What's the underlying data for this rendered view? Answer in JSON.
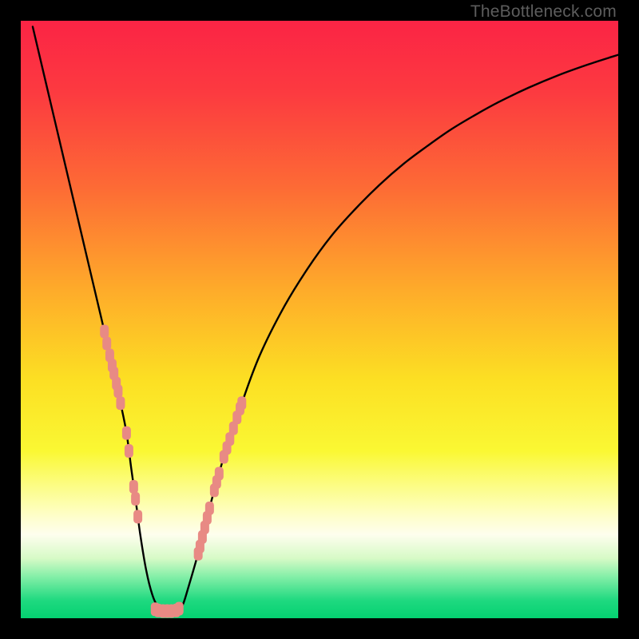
{
  "watermark": "TheBottleneck.com",
  "colors": {
    "frame": "#000000",
    "curve": "#000000",
    "marker_fill": "#e88a84",
    "marker_stroke": "#e88a84",
    "gradient_stops": [
      {
        "offset": "0%",
        "color": "#fb2445"
      },
      {
        "offset": "12%",
        "color": "#fc3a40"
      },
      {
        "offset": "28%",
        "color": "#fd6b35"
      },
      {
        "offset": "45%",
        "color": "#feab2a"
      },
      {
        "offset": "60%",
        "color": "#fcdf23"
      },
      {
        "offset": "72%",
        "color": "#faf833"
      },
      {
        "offset": "78%",
        "color": "#fcfd87"
      },
      {
        "offset": "83%",
        "color": "#fefecb"
      },
      {
        "offset": "86%",
        "color": "#fefeee"
      },
      {
        "offset": "90%",
        "color": "#d6fac6"
      },
      {
        "offset": "93%",
        "color": "#85efa8"
      },
      {
        "offset": "97%",
        "color": "#1fd980"
      },
      {
        "offset": "100%",
        "color": "#04d171"
      }
    ]
  },
  "chart_data": {
    "type": "line",
    "title": "",
    "xlabel": "",
    "ylabel": "",
    "xlim": [
      0,
      100
    ],
    "ylim": [
      0,
      100
    ],
    "x": [
      0,
      2,
      4,
      6,
      8,
      10,
      12,
      14,
      15.6,
      16.7,
      17.7,
      18.5,
      19.2,
      20,
      21,
      22,
      23,
      24.5,
      26,
      27,
      28,
      30,
      32,
      34,
      37,
      40,
      44,
      48,
      52,
      56,
      60,
      64,
      68,
      72,
      76,
      80,
      85,
      90,
      95,
      100
    ],
    "values": [
      null,
      99,
      90.5,
      82,
      73.5,
      65,
      56.5,
      48,
      41,
      36,
      31,
      25,
      20,
      14,
      8,
      4,
      2,
      1.2,
      1.2,
      2,
      5,
      12,
      20,
      27,
      36,
      44,
      52,
      58.5,
      64,
      68.5,
      72.5,
      76,
      79,
      81.8,
      84.2,
      86.4,
      88.8,
      90.9,
      92.7,
      94.3
    ],
    "series": [
      {
        "name": "markers-left-upper",
        "x": [
          14.0,
          14.4,
          14.9,
          15.3,
          15.6,
          16.0,
          16.3,
          16.7
        ],
        "y": [
          48.0,
          46.0,
          44.0,
          42.3,
          41.0,
          39.3,
          38.0,
          36.0
        ]
      },
      {
        "name": "markers-left-mid",
        "x": [
          17.7,
          18.1
        ],
        "y": [
          31.0,
          28.0
        ]
      },
      {
        "name": "markers-left-lower",
        "x": [
          18.9,
          19.2,
          19.6
        ],
        "y": [
          22.0,
          20.0,
          17.0
        ]
      },
      {
        "name": "markers-valley",
        "x": [
          22.5,
          23.0,
          23.8,
          24.5,
          25.2,
          26.0,
          26.5
        ],
        "y": [
          1.5,
          1.3,
          1.2,
          1.2,
          1.2,
          1.3,
          1.6
        ]
      },
      {
        "name": "markers-right-lower",
        "x": [
          29.7,
          30.0,
          30.4,
          30.8,
          31.2,
          31.6
        ],
        "y": [
          10.8,
          12.0,
          13.6,
          15.2,
          16.8,
          18.4
        ]
      },
      {
        "name": "markers-right-mid",
        "x": [
          32.4,
          32.8,
          33.2
        ],
        "y": [
          21.4,
          22.8,
          24.2
        ]
      },
      {
        "name": "markers-right-upper",
        "x": [
          34.0,
          34.5,
          35.0,
          35.6,
          36.2,
          36.7,
          37.0
        ],
        "y": [
          27.0,
          28.5,
          30.0,
          31.8,
          33.6,
          35.1,
          36.0
        ]
      }
    ]
  }
}
